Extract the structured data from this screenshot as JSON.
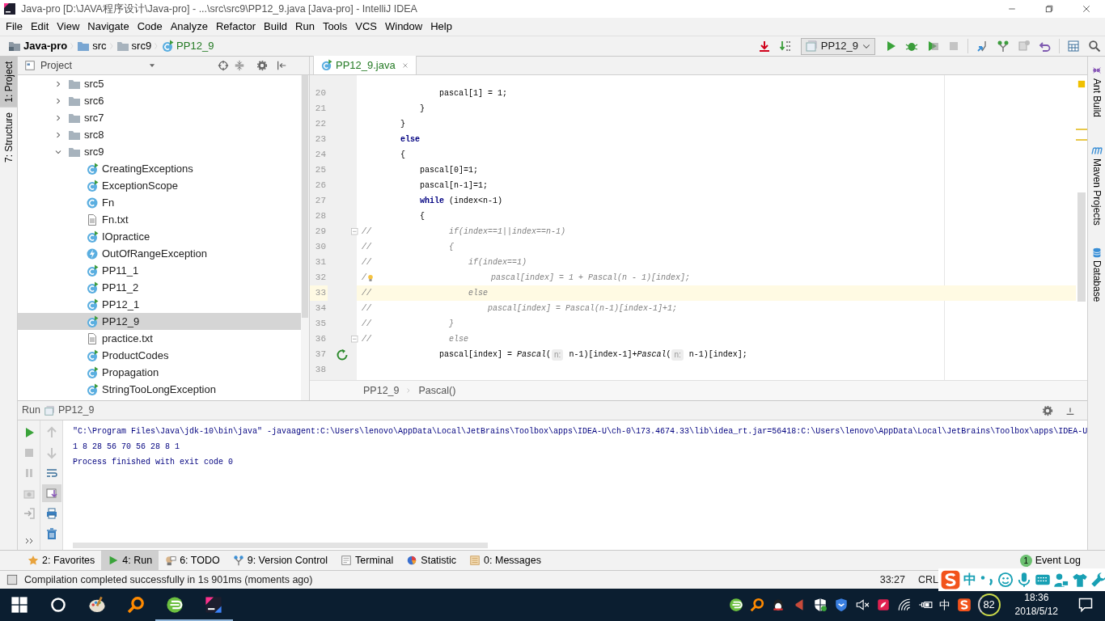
{
  "window": {
    "title": "Java-pro [D:\\JAVA程序设计\\Java-pro] - ...\\src\\src9\\PP12_9.java [Java-pro] - IntelliJ IDEA"
  },
  "menu": [
    "File",
    "Edit",
    "View",
    "Navigate",
    "Code",
    "Analyze",
    "Refactor",
    "Build",
    "Run",
    "Tools",
    "VCS",
    "Window",
    "Help"
  ],
  "breadcrumbs": [
    {
      "label": "Java-pro",
      "kind": "project"
    },
    {
      "label": "src",
      "kind": "source"
    },
    {
      "label": "src9",
      "kind": "folder"
    },
    {
      "label": "PP12_9",
      "kind": "class"
    }
  ],
  "toolbar": {
    "run_config": "PP12_9"
  },
  "left_tool_tabs": [
    {
      "label": "1: Project",
      "selected": true
    },
    {
      "label": "7: Structure",
      "selected": false
    }
  ],
  "right_tool_tabs": [
    {
      "label": "Ant Build",
      "kind": "ant"
    },
    {
      "label": "Maven Projects",
      "kind": "maven"
    },
    {
      "label": "Database",
      "kind": "database"
    }
  ],
  "project_panel": {
    "title": "Project",
    "tree": [
      {
        "label": "src5",
        "kind": "folder",
        "expanded": false,
        "selected": false
      },
      {
        "label": "src6",
        "kind": "folder",
        "expanded": false,
        "selected": false
      },
      {
        "label": "src7",
        "kind": "folder",
        "expanded": false,
        "selected": false
      },
      {
        "label": "src8",
        "kind": "folder",
        "expanded": false,
        "selected": false
      },
      {
        "label": "src9",
        "kind": "folder",
        "expanded": true,
        "selected": false,
        "children": [
          {
            "label": "CreatingExceptions",
            "kind": "main",
            "selected": false
          },
          {
            "label": "ExceptionScope",
            "kind": "main",
            "selected": false
          },
          {
            "label": "Fn",
            "kind": "class",
            "selected": false
          },
          {
            "label": "Fn.txt",
            "kind": "text",
            "selected": false
          },
          {
            "label": "IOpractice",
            "kind": "main",
            "selected": false
          },
          {
            "label": "OutOfRangeException",
            "kind": "exception",
            "selected": false
          },
          {
            "label": "PP11_1",
            "kind": "main",
            "selected": false
          },
          {
            "label": "PP11_2",
            "kind": "main",
            "selected": false
          },
          {
            "label": "PP12_1",
            "kind": "main",
            "selected": false
          },
          {
            "label": "PP12_9",
            "kind": "main",
            "selected": true
          },
          {
            "label": "practice.txt",
            "kind": "text",
            "selected": false
          },
          {
            "label": "ProductCodes",
            "kind": "main",
            "selected": false
          },
          {
            "label": "Propagation",
            "kind": "main",
            "selected": false
          },
          {
            "label": "StringTooLongException",
            "kind": "main",
            "selected": false
          }
        ]
      }
    ]
  },
  "editor": {
    "tabs": [
      {
        "label": "PP12_9.java",
        "selected": true
      }
    ],
    "lines": [
      {
        "number": "20",
        "current": false,
        "fold": false,
        "recursive": false,
        "parts": [
          {
            "kind": "code",
            "text": "                pascal[1] = 1;"
          }
        ]
      },
      {
        "number": "21",
        "current": false,
        "fold": false,
        "recursive": false,
        "parts": [
          {
            "kind": "code",
            "text": "            }"
          }
        ]
      },
      {
        "number": "22",
        "current": false,
        "fold": false,
        "recursive": false,
        "parts": [
          {
            "kind": "code",
            "text": "        }"
          }
        ]
      },
      {
        "number": "23",
        "current": false,
        "fold": false,
        "recursive": false,
        "parts": [
          {
            "kind": "code",
            "text": "        **else**"
          }
        ]
      },
      {
        "number": "24",
        "current": false,
        "fold": false,
        "recursive": false,
        "parts": [
          {
            "kind": "code",
            "text": "        {"
          }
        ]
      },
      {
        "number": "25",
        "current": false,
        "fold": false,
        "recursive": false,
        "parts": [
          {
            "kind": "code",
            "text": "            pascal[0]=1;"
          }
        ]
      },
      {
        "number": "26",
        "current": false,
        "fold": false,
        "recursive": false,
        "parts": [
          {
            "kind": "code",
            "text": "            pascal[n-1]=1;"
          }
        ]
      },
      {
        "number": "27",
        "current": false,
        "fold": false,
        "recursive": false,
        "parts": [
          {
            "kind": "code",
            "text": "            **while** (index<n-1)"
          }
        ]
      },
      {
        "number": "28",
        "current": false,
        "fold": false,
        "recursive": false,
        "parts": [
          {
            "kind": "code",
            "text": "            {"
          }
        ]
      },
      {
        "number": "29",
        "current": false,
        "fold": true,
        "recursive": false,
        "parts": [
          {
            "kind": "comment",
            "text": "//                if(index==1||index==n-1)"
          }
        ]
      },
      {
        "number": "30",
        "current": false,
        "fold": false,
        "recursive": false,
        "parts": [
          {
            "kind": "comment",
            "text": "//                {"
          }
        ]
      },
      {
        "number": "31",
        "current": false,
        "fold": false,
        "recursive": false,
        "parts": [
          {
            "kind": "comment",
            "text": "//                    if(index==1)"
          }
        ]
      },
      {
        "number": "32",
        "current": false,
        "fold": false,
        "recursive": false,
        "parts": [
          {
            "kind": "comment",
            "text": "/"
          },
          {
            "kind": "bulb"
          },
          {
            "kind": "comment",
            "text": "                        pascal[index] = 1 + Pascal(n - 1)[index];"
          }
        ]
      },
      {
        "number": "33",
        "current": true,
        "fold": false,
        "recursive": false,
        "parts": [
          {
            "kind": "comment",
            "text": "//                    else"
          }
        ]
      },
      {
        "number": "34",
        "current": false,
        "fold": false,
        "recursive": false,
        "parts": [
          {
            "kind": "comment",
            "text": "//                        pascal[index] = Pascal(n-1)[index-1]+1;"
          }
        ]
      },
      {
        "number": "35",
        "current": false,
        "fold": false,
        "recursive": false,
        "parts": [
          {
            "kind": "comment",
            "text": "//                }"
          }
        ]
      },
      {
        "number": "36",
        "current": false,
        "fold": true,
        "recursive": false,
        "parts": [
          {
            "kind": "comment",
            "text": "//                else"
          }
        ]
      },
      {
        "number": "37",
        "current": false,
        "fold": false,
        "recursive": true,
        "parts": [
          {
            "kind": "code",
            "text": "                pascal[index] = *Pascal*("
          },
          {
            "kind": "hint",
            "text": "n:"
          },
          {
            "kind": "code",
            "text": " n-1)[index-1]+*Pascal*("
          },
          {
            "kind": "hint",
            "text": "n:"
          },
          {
            "kind": "code",
            "text": " n-1)[index];"
          }
        ]
      },
      {
        "number": "38",
        "current": false,
        "fold": false,
        "recursive": false
      }
    ],
    "breadcrumb": [
      "PP12_9",
      "Pascal()"
    ]
  },
  "run_panel": {
    "title": "Run",
    "tab": "PP12_9",
    "console": [
      "\"C:\\Program Files\\Java\\jdk-10\\bin\\java\" -javaagent:C:\\Users\\lenovo\\AppData\\Local\\JetBrains\\Toolbox\\apps\\IDEA-U\\ch-0\\173.4674.33\\lib\\idea_rt.jar=56418:C:\\Users\\lenovo\\AppData\\Local\\JetBrains\\Toolbox\\apps\\IDEA-U",
      "1 8 28 56 70 56 28 8 1",
      "Process finished with exit code 0"
    ]
  },
  "tool_window_bar": [
    {
      "label": "2: Favorites",
      "kind": "favorites",
      "selected": false
    },
    {
      "label": "4: Run",
      "kind": "run",
      "selected": true
    },
    {
      "label": "6: TODO",
      "kind": "todo",
      "selected": false
    },
    {
      "label": "9: Version Control",
      "kind": "vcs",
      "selected": false
    },
    {
      "label": "Terminal",
      "kind": "terminal",
      "selected": false
    },
    {
      "label": "Statistic",
      "kind": "statistic",
      "selected": false
    },
    {
      "label": "0: Messages",
      "kind": "messages",
      "selected": false
    }
  ],
  "event_log": {
    "label": "Event Log",
    "count": "1"
  },
  "status_bar": {
    "message": "Compilation completed successfully in 1s 901ms (moments ago)",
    "position": "33:27",
    "line_separator": "CRL"
  },
  "ime_bar": {
    "mode": "中"
  },
  "taskbar": {
    "tray_language": "中",
    "battery": "82",
    "time": "18:36",
    "date": "2018/5/12"
  }
}
